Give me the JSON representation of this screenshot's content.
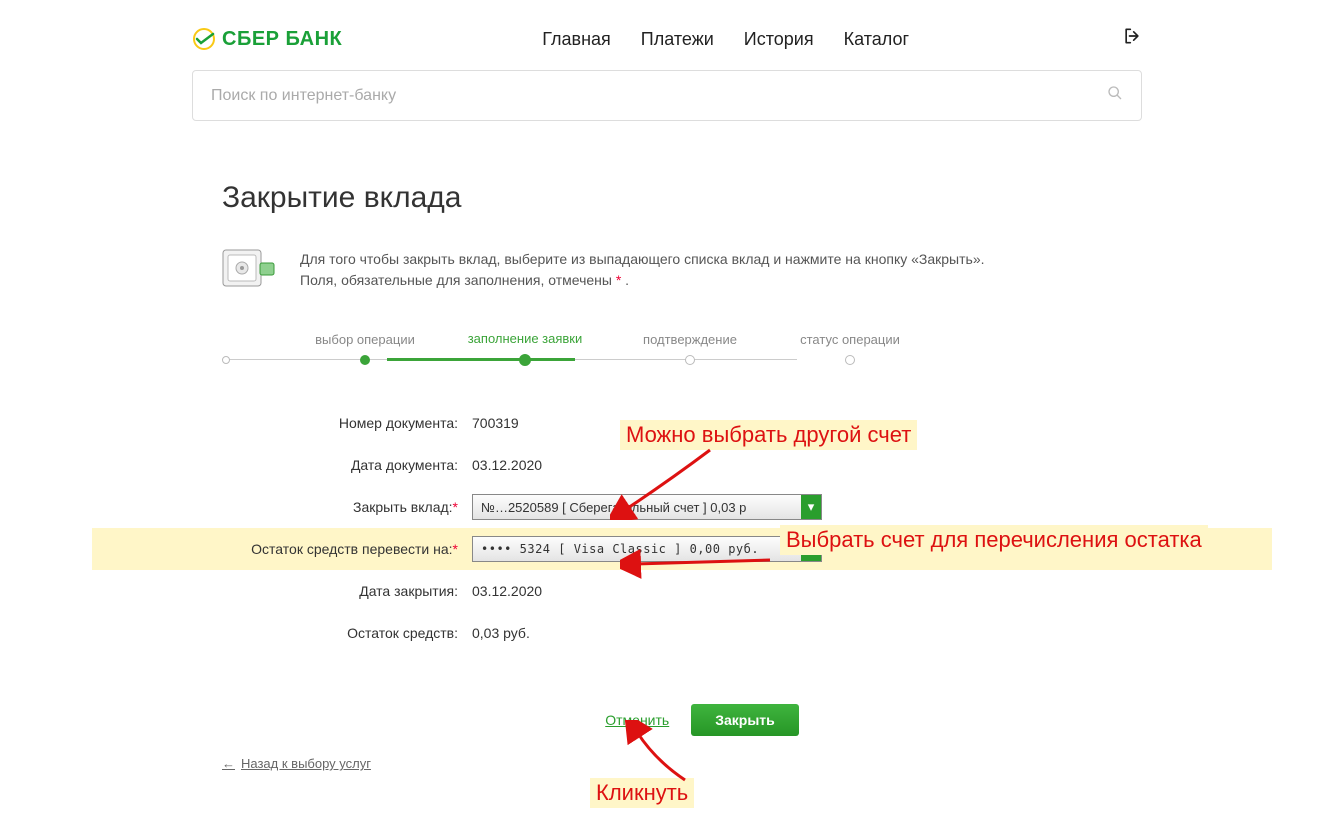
{
  "brand": {
    "name": "СБЕР БАНК"
  },
  "nav": {
    "items": [
      "Главная",
      "Платежи",
      "История",
      "Каталог"
    ]
  },
  "search": {
    "placeholder": "Поиск по интернет-банку"
  },
  "page": {
    "title": "Закрытие вклада"
  },
  "intro": {
    "line1": "Для того чтобы закрыть вклад, выберите из выпадающего списка вклад и нажмите на кнопку «Закрыть».",
    "line2_a": "Поля, обязательные для заполнения, отмечены ",
    "line2_b": "*",
    "line2_c": " ."
  },
  "steps": {
    "s1": "выбор операции",
    "s2": "заполнение заявки",
    "s3": "подтверждение",
    "s4": "статус операции"
  },
  "form": {
    "doc_number_label": "Номер документа:",
    "doc_number_value": "700319",
    "doc_date_label": "Дата документа:",
    "doc_date_value": "03.12.2020",
    "close_label": "Закрыть вклад:",
    "close_select": "№…2520589  [ Сберегательный счет ]  0,03 р",
    "transfer_label": "Остаток средств перевести на:",
    "transfer_select": "•••• 5324   [ Visa Classic ] 0,00   руб.",
    "close_date_label": "Дата закрытия:",
    "close_date_value": "03.12.2020",
    "balance_label": "Остаток средств:",
    "balance_value": "0,03 руб."
  },
  "actions": {
    "cancel": "Отменить",
    "submit": "Закрыть"
  },
  "back_link": "Назад к выбору услуг",
  "annotations": {
    "a1": "Можно выбрать другой счет",
    "a2": "Выбрать счет для перечисления остатка",
    "a3": "Кликнуть"
  }
}
